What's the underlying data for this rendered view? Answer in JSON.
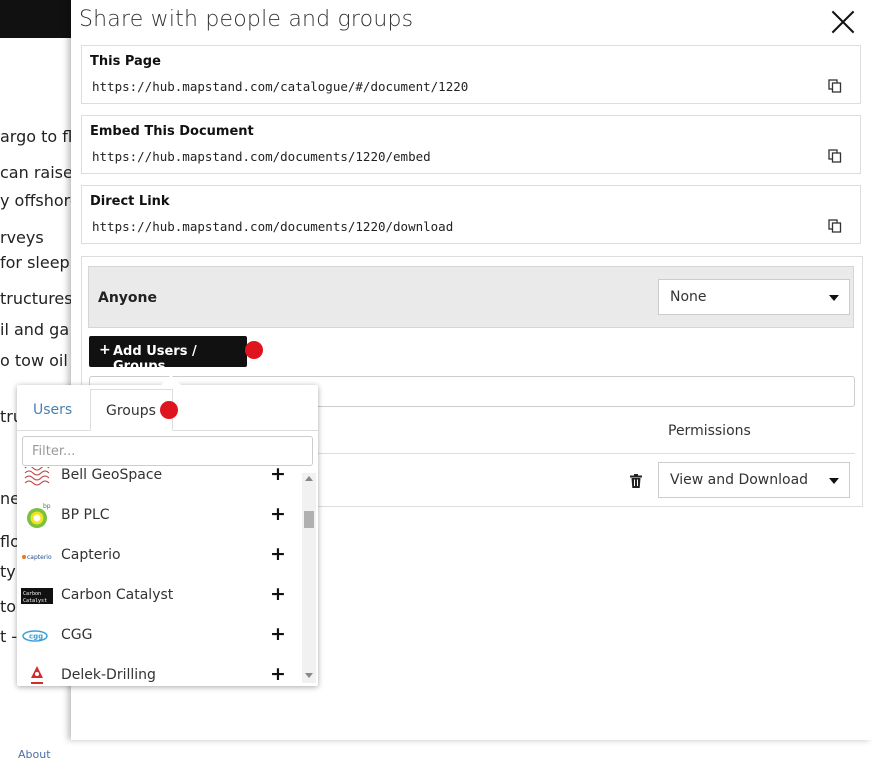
{
  "background": {
    "lines": [
      "argo to fl",
      "can raise",
      "y offshore",
      "rveys",
      "for sleepi",
      "tructures",
      "il and ga",
      "o tow oil",
      "tru",
      "ne",
      "flo",
      "ty",
      "tor",
      "t -"
    ],
    "footer_link": "About"
  },
  "modal": {
    "title": "Share with people and groups",
    "links": [
      {
        "title": "This Page",
        "url": "https://hub.mapstand.com/catalogue/#/document/1220"
      },
      {
        "title": "Embed This Document",
        "url": "https://hub.mapstand.com/documents/1220/embed"
      },
      {
        "title": "Direct Link",
        "url": "https://hub.mapstand.com/documents/1220/download"
      }
    ],
    "anyone_label": "Anyone",
    "anyone_permission": "None",
    "add_button_label": "Add Users / Groups",
    "permissions_header": "Permissions",
    "entry_permission": "View and Download"
  },
  "popover": {
    "tabs": [
      "Users",
      "Groups"
    ],
    "active_tab": "Groups",
    "filter_placeholder": "Filter...",
    "groups": [
      {
        "name": "Bell GeoSpace",
        "icon": "bell-geospace-logo"
      },
      {
        "name": "BP PLC",
        "icon": "bp-logo"
      },
      {
        "name": "Capterio",
        "icon": "capterio-logo"
      },
      {
        "name": "Carbon Catalyst",
        "icon": "carbon-catalyst-logo"
      },
      {
        "name": "CGG",
        "icon": "cgg-logo"
      },
      {
        "name": "Delek-Drilling",
        "icon": "delek-drilling-logo"
      }
    ]
  },
  "colors": {
    "accent_dark": "#111111",
    "marker_red": "#e0141e",
    "users_tab": "#4a7fb0"
  }
}
